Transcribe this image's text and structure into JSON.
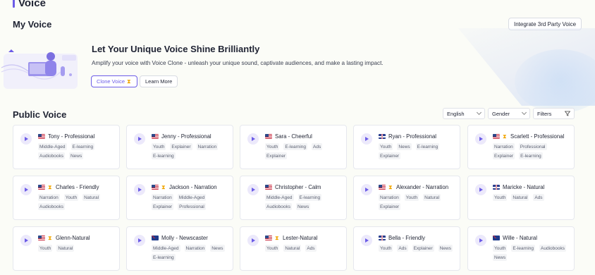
{
  "page": {
    "title": "Voice"
  },
  "my_voice": {
    "section_title": "My Voice",
    "integrate_label": "Integrate 3rd Party Voice",
    "heading": "Let Your Unique Voice Shine Brilliantly",
    "subtitle": "Amplify your voice with Voice Clone - unleash your unique sound, captivate audiences, and make a lasting impact.",
    "clone_label": "Clone Voice",
    "learn_label": "Learn More"
  },
  "public_voice": {
    "section_title": "Public Voice",
    "language": "English",
    "gender": "Gender",
    "filters": "Filters"
  },
  "colors": {
    "accent": "#6c5ce7",
    "coin": "#f0a500"
  },
  "voices": [
    {
      "name": "Tony - Professional",
      "flag": "us-flag",
      "premium": false,
      "tags": [
        "Middle-Aged",
        "E-learning",
        "Audiobooks",
        "News"
      ]
    },
    {
      "name": "Jenny - Professional",
      "flag": "us-flag",
      "premium": false,
      "tags": [
        "Youth",
        "Explainer",
        "Narration",
        "E-learning"
      ]
    },
    {
      "name": "Sara - Cheerful",
      "flag": "us-flag",
      "premium": false,
      "tags": [
        "Youth",
        "E-learning",
        "Ads",
        "Explainer"
      ]
    },
    {
      "name": "Ryan - Professional",
      "flag": "gb-flag",
      "premium": false,
      "tags": [
        "Youth",
        "News",
        "E-learning",
        "Explainer"
      ]
    },
    {
      "name": "Scarlett - Professional",
      "flag": "us-flag",
      "premium": true,
      "tags": [
        "Narration",
        "Professional",
        "Explainer",
        "E-learning"
      ]
    },
    {
      "name": "Charles - Friendly",
      "flag": "us-flag",
      "premium": true,
      "tags": [
        "Narration",
        "Youth",
        "Natural",
        "Audiobooks"
      ]
    },
    {
      "name": "Jackson - Narration",
      "flag": "us-flag",
      "premium": true,
      "tags": [
        "Narration",
        "Middle-Aged",
        "Explainer",
        "Professional"
      ]
    },
    {
      "name": "Christopher - Calm",
      "flag": "us-flag",
      "premium": false,
      "tags": [
        "Middle-Aged",
        "E-learning",
        "Audiobooks",
        "News"
      ]
    },
    {
      "name": "Alexander - Narration",
      "flag": "us-flag",
      "premium": true,
      "tags": [
        "Narration",
        "Youth",
        "Natural",
        "Explainer"
      ]
    },
    {
      "name": "Maricke - Natural",
      "flag": "gb-flag",
      "premium": false,
      "tags": [
        "Youth",
        "Natural",
        "Ads"
      ]
    },
    {
      "name": "Glenn-Natural",
      "flag": "us-flag",
      "premium": true,
      "tags": [
        "Youth",
        "Natural"
      ]
    },
    {
      "name": "Molly - Newscaster",
      "flag": "au-flag",
      "premium": false,
      "tags": [
        "Middle-Aged",
        "Narration",
        "News",
        "E-learning"
      ]
    },
    {
      "name": "Lester-Natural",
      "flag": "us-flag",
      "premium": true,
      "tags": [
        "Youth",
        "Natural",
        "Ads"
      ]
    },
    {
      "name": "Bella - Friendly",
      "flag": "gb-flag",
      "premium": false,
      "tags": [
        "Youth",
        "Ads",
        "Explainer",
        "News"
      ]
    },
    {
      "name": "Wille - Natural",
      "flag": "au-flag",
      "premium": false,
      "tags": [
        "Youth",
        "E-learning",
        "Audiobooks",
        "News"
      ]
    }
  ]
}
